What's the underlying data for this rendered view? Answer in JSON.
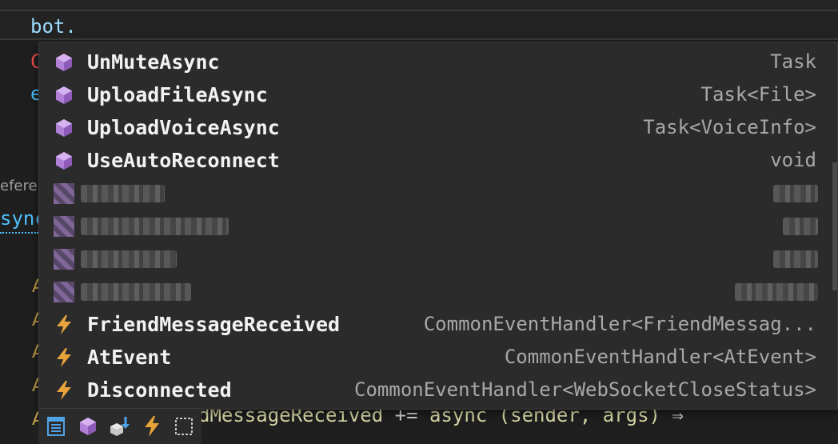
{
  "editor": {
    "bot_line": "bot.",
    "frag_red": "C",
    "frag_e": "e",
    "frag_refer": "eferer",
    "frag_sync": "sync",
    "left_marker": "A",
    "bottom_code_a": "dMessageReceived",
    "bottom_code_b": " += ",
    "bottom_code_c": "async (sender, args) ",
    "bottom_code_arrow": "⇒"
  },
  "completion": {
    "items": [
      {
        "label": "UnMuteAsync",
        "type": "Task",
        "kind": "method-icon"
      },
      {
        "label": "UploadFileAsync",
        "type": "Task<File>",
        "kind": "method-icon"
      },
      {
        "label": "UploadVoiceAsync",
        "type": "Task<VoiceInfo>",
        "kind": "method-icon"
      },
      {
        "label": "UseAutoReconnect",
        "type": "void",
        "kind": "method-icon"
      },
      {
        "label": "FriendMessageReceived",
        "type": "CommonEventHandler<FriendMessag...",
        "kind": "event-icon"
      },
      {
        "label": "AtEvent",
        "type": "CommonEventHandler<AtEvent>",
        "kind": "event-icon"
      },
      {
        "label": "Disconnected",
        "type": "CommonEventHandler<WebSocketCloseStatus>",
        "kind": "event-icon"
      }
    ]
  },
  "filters": [
    "properties-filter-icon",
    "methods-filter-icon",
    "extension-methods-filter-icon",
    "events-filter-icon",
    "snippets-filter-icon"
  ],
  "colors": {
    "method_icon": "#b180d7",
    "event_icon": "#e8a33b",
    "popup_bg": "#2b2b2b"
  }
}
